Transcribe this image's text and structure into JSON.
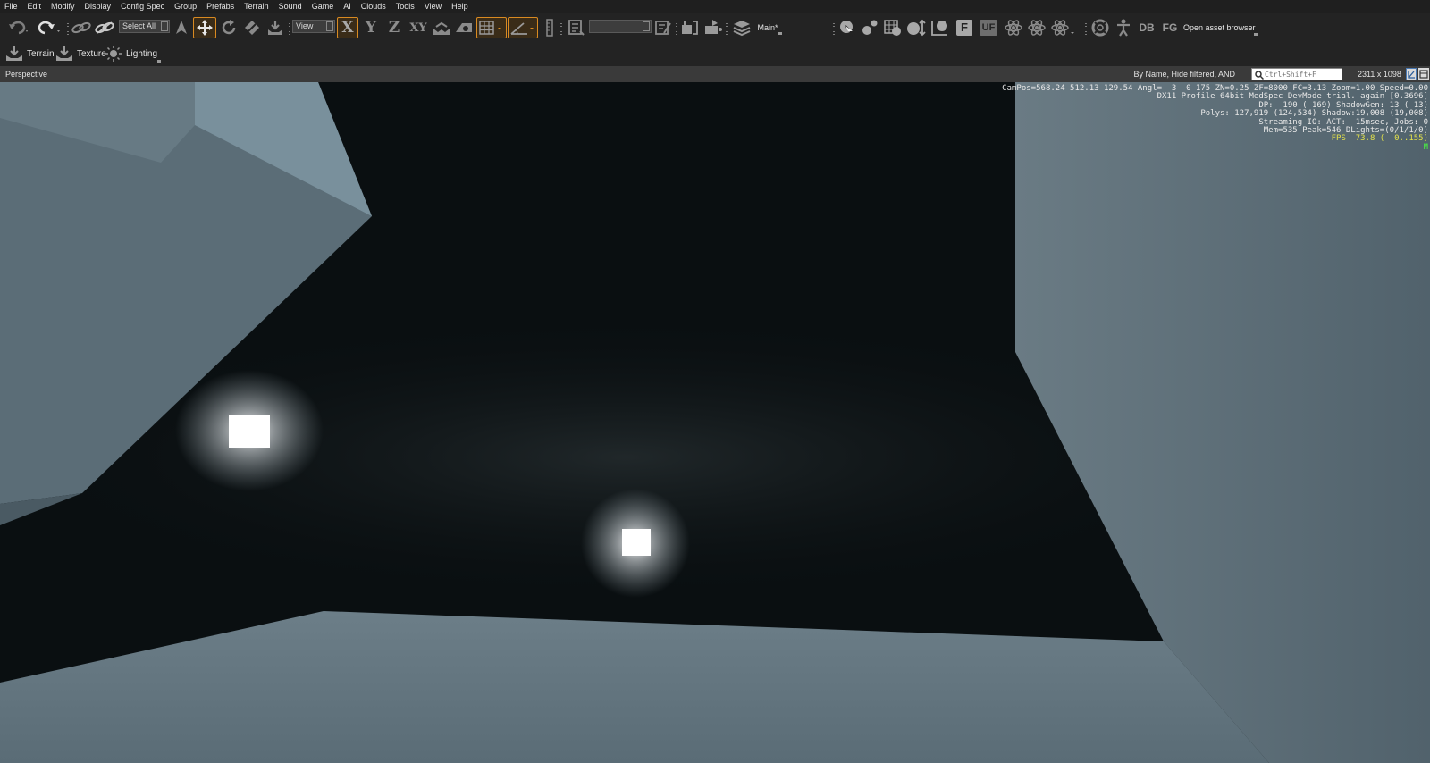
{
  "menu": [
    "File",
    "Edit",
    "Modify",
    "Display",
    "Config Spec",
    "Group",
    "Prefabs",
    "Terrain",
    "Sound",
    "Game",
    "AI",
    "Clouds",
    "Tools",
    "View",
    "Help"
  ],
  "toolbar": {
    "select_mode": "Select All",
    "ref_coord": "View",
    "axis_x": "X",
    "axis_y": "Y",
    "axis_z": "Z",
    "axis_xy": "XY",
    "layer": "Main*",
    "btn_f": "F",
    "btn_uf": "UF",
    "btn_db": "DB",
    "btn_fg": "FG",
    "asset_browser": "Open asset browser",
    "accent": "#d98a21"
  },
  "toolbar2": {
    "terrain": "Terrain",
    "texture": "Texture",
    "lighting": "Lighting"
  },
  "viewport_bar": {
    "title": "Perspective",
    "filter": "By Name, Hide filtered, AND",
    "search_placeholder": "Ctrl+Shift+F",
    "resolution": "2311 x 1098"
  },
  "debug": {
    "line1": "CamPos=568.24 512.13 129.54 Angl=  3  0 175 ZN=0.25 ZF=8000 FC=3.13 Zoom=1.00 Speed=0.00",
    "line2": "DX11 Profile 64bit MedSpec DevMode trial. again [0.3696]",
    "line3": "DP:  190 ( 169) ShadowGen: 13 ( 13)",
    "line4": "Polys: 127,919 (124,534) Shadow:19,008 (19,008)",
    "line5": "Streaming IO: ACT:  15msec, Jobs: 0",
    "line6": "Mem=535 Peak=546 DLights=(0/1/1/0)",
    "fps": "FPS  73.8 (  0..155)",
    "mode": "M"
  }
}
